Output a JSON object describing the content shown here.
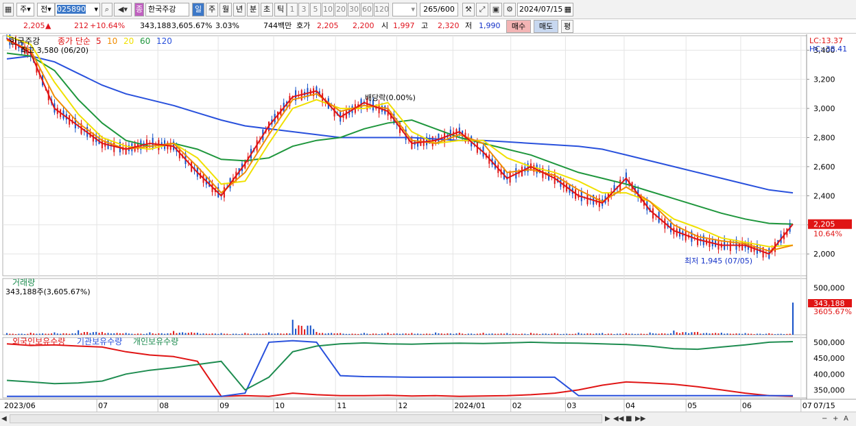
{
  "toolbar": {
    "period_type": "주",
    "all_label": "전",
    "code": "025890",
    "stock_name": "한국주강",
    "periods": [
      "일",
      "주",
      "월",
      "년",
      "분",
      "초",
      "틱"
    ],
    "active_period": "일",
    "minute_options": [
      "1",
      "3",
      "5",
      "10",
      "20",
      "30",
      "60",
      "120"
    ],
    "count": "265",
    "count_max": "/600",
    "date": "2024/07/15"
  },
  "quote": {
    "price": "2,205",
    "arrow": "▲",
    "change": "212",
    "change_pct": "+10.64%",
    "volume": "343,188",
    "volume_pct": "3,605.67%",
    "turnover_rate": "3.03%",
    "amount": "744백만",
    "bid_label": "호가",
    "ask": "2,205",
    "bid": "2,200",
    "open_label": "시",
    "open": "1,997",
    "high_label": "고",
    "high": "2,320",
    "low_label": "저",
    "low": "1,990",
    "buy_label": "매수",
    "sell_label": "매도",
    "eval_label": "평"
  },
  "legend": {
    "name": "한국주강",
    "ma_label": "종가 단순",
    "ma_periods": [
      "5",
      "10",
      "20",
      "60",
      "120"
    ],
    "ma_colors": [
      "#e01414",
      "#f08c00",
      "#f0e000",
      "#1e963c",
      "#2850dc"
    ],
    "high_note": "최고 3,580 (06/20)",
    "dividend_note": "배당락(0.00%)",
    "low_note": "최저 1,945 (07/05)",
    "lc": "LC:13.37",
    "hc": "HC:-38.41",
    "price_tag": "2,205",
    "pct_tag": "10.64%"
  },
  "volume_panel": {
    "title": "거래량",
    "subtitle": "343,188주(3,605.67%)",
    "tag_value": "343,188",
    "tag_pct": "3605.67%"
  },
  "holding_panel": {
    "titles": [
      "외국인보유수량",
      "기관보유수량",
      "개인보유수량"
    ],
    "colors": [
      "#e01414",
      "#2850dc",
      "#1e8c50"
    ]
  },
  "axis": {
    "x_labels": [
      "2023/06",
      "07",
      "08",
      "09",
      "10",
      "11",
      "12",
      "2024/01",
      "02",
      "03",
      "04",
      "05",
      "06",
      "07",
      "07/15"
    ],
    "price_ticks": [
      "3,400",
      "3,200",
      "3,000",
      "2,800",
      "2,600",
      "2,400",
      "2,200",
      "2,000"
    ],
    "volume_ticks": [
      "500,000"
    ],
    "holding_ticks": [
      "500,000",
      "450,000",
      "400,000",
      "350,000"
    ]
  },
  "chart_data": {
    "type": "line",
    "title": "한국주강",
    "price_ylim": [
      1850,
      3500
    ],
    "volume_ylim": [
      0,
      600000
    ],
    "holding_ylim": [
      325000,
      515000
    ],
    "x": [
      "2023/06",
      "07",
      "08",
      "09",
      "10",
      "11",
      "12",
      "2024/01",
      "02",
      "03",
      "04",
      "05",
      "06",
      "07"
    ],
    "series": [
      {
        "name": "5",
        "values": [
          3480,
          3380,
          3000,
          2880,
          2760,
          2720,
          2760,
          2740,
          2560,
          2400,
          2620,
          2880,
          3080,
          3120,
          2940,
          3040,
          2980,
          2760,
          2780,
          2840,
          2700,
          2520,
          2600,
          2520,
          2400,
          2350,
          2520,
          2300,
          2160,
          2100,
          2060,
          2060,
          2000,
          2205
        ]
      },
      {
        "name": "10",
        "values": [
          3470,
          3400,
          3080,
          2900,
          2780,
          2720,
          2740,
          2760,
          2600,
          2420,
          2560,
          2820,
          3060,
          3100,
          2980,
          3020,
          3000,
          2780,
          2760,
          2820,
          2760,
          2560,
          2580,
          2540,
          2440,
          2360,
          2460,
          2360,
          2200,
          2120,
          2090,
          2070,
          2020,
          2060
        ]
      },
      {
        "name": "20",
        "values": [
          3500,
          3440,
          3180,
          2960,
          2800,
          2740,
          2720,
          2760,
          2660,
          2480,
          2500,
          2760,
          3000,
          3060,
          3000,
          3000,
          3040,
          2840,
          2760,
          2780,
          2780,
          2660,
          2600,
          2560,
          2500,
          2420,
          2420,
          2360,
          2240,
          2180,
          2110,
          2080,
          2050,
          2060
        ]
      },
      {
        "name": "60",
        "values": [
          3380,
          3360,
          3260,
          3060,
          2900,
          2780,
          2740,
          2760,
          2720,
          2650,
          2640,
          2660,
          2740,
          2780,
          2800,
          2860,
          2900,
          2920,
          2860,
          2800,
          2760,
          2720,
          2680,
          2620,
          2560,
          2520,
          2480,
          2430,
          2380,
          2330,
          2280,
          2240,
          2210,
          2205
        ]
      },
      {
        "name": "120",
        "values": [
          3340,
          3360,
          3320,
          3240,
          3160,
          3100,
          3060,
          3020,
          2970,
          2920,
          2880,
          2860,
          2840,
          2820,
          2800,
          2800,
          2800,
          2800,
          2790,
          2780,
          2780,
          2770,
          2760,
          2750,
          2740,
          2720,
          2680,
          2640,
          2600,
          2560,
          2520,
          2480,
          2440,
          2420
        ]
      }
    ],
    "volume_values": [
      18000,
      22000,
      25000,
      48000,
      30000,
      20000,
      26000,
      40000,
      22000,
      18000,
      20000,
      25000,
      160000,
      30000,
      18000,
      20000,
      22000,
      19000,
      24000,
      20000,
      21000,
      18000,
      20000,
      17000,
      23000,
      19000,
      18000,
      24000,
      45000,
      30000,
      22000,
      18000,
      16000,
      343188
    ],
    "holding_series": [
      {
        "name": "외국인보유수량",
        "values": [
          495000,
          490000,
          492000,
          488000,
          485000,
          470000,
          460000,
          455000,
          440000,
          330000,
          332000,
          330000,
          340000,
          335000,
          332000,
          332000,
          333000,
          331000,
          332000,
          330000,
          331000,
          332000,
          335000,
          340000,
          350000,
          365000,
          375000,
          372000,
          368000,
          360000,
          350000,
          340000,
          332000,
          330000
        ]
      },
      {
        "name": "기관보유수량",
        "values": [
          330000,
          330000,
          330000,
          330000,
          330000,
          330000,
          330000,
          330000,
          330000,
          330000,
          340000,
          500000,
          505000,
          500000,
          395000,
          392000,
          391000,
          390000,
          390000,
          390000,
          390000,
          390000,
          390000,
          390000,
          332000,
          332000,
          332000,
          332000,
          332000,
          332000,
          332000,
          332000,
          332000,
          332000
        ]
      },
      {
        "name": "개인보유수량",
        "values": [
          380000,
          375000,
          370000,
          372000,
          378000,
          400000,
          412000,
          420000,
          430000,
          440000,
          350000,
          390000,
          470000,
          488000,
          495000,
          498000,
          495000,
          494000,
          496000,
          497000,
          496000,
          498000,
          500000,
          498000,
          497000,
          495000,
          493000,
          488000,
          480000,
          478000,
          485000,
          492000,
          500000,
          502000
        ]
      }
    ]
  }
}
